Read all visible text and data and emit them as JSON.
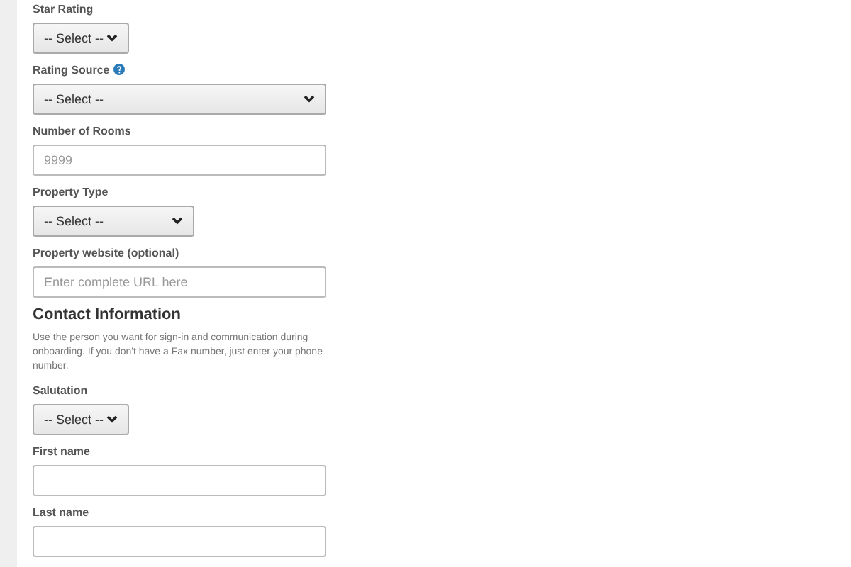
{
  "property_fields": [
    {
      "kind": "select",
      "label": "Star Rating",
      "value": "-- Select --"
    },
    {
      "kind": "select",
      "label": "Rating Source",
      "help": true,
      "value": "-- Select --"
    },
    {
      "kind": "input",
      "label": "Number of Rooms",
      "placeholder": "9999"
    },
    {
      "kind": "select",
      "label": "Property Type",
      "value": "-- Select --"
    },
    {
      "kind": "input",
      "label": "Property website (optional)",
      "placeholder": "Enter complete URL here"
    }
  ],
  "contact": {
    "heading": "Contact Information",
    "description": "Use the person you want for sign-in and communication during onboarding. If you don't have a Fax number, just enter your phone number.",
    "fields": [
      {
        "kind": "select",
        "label": "Salutation",
        "value": "-- Select --"
      },
      {
        "kind": "input",
        "label": "First name"
      },
      {
        "kind": "input",
        "label": "Last name"
      }
    ]
  }
}
